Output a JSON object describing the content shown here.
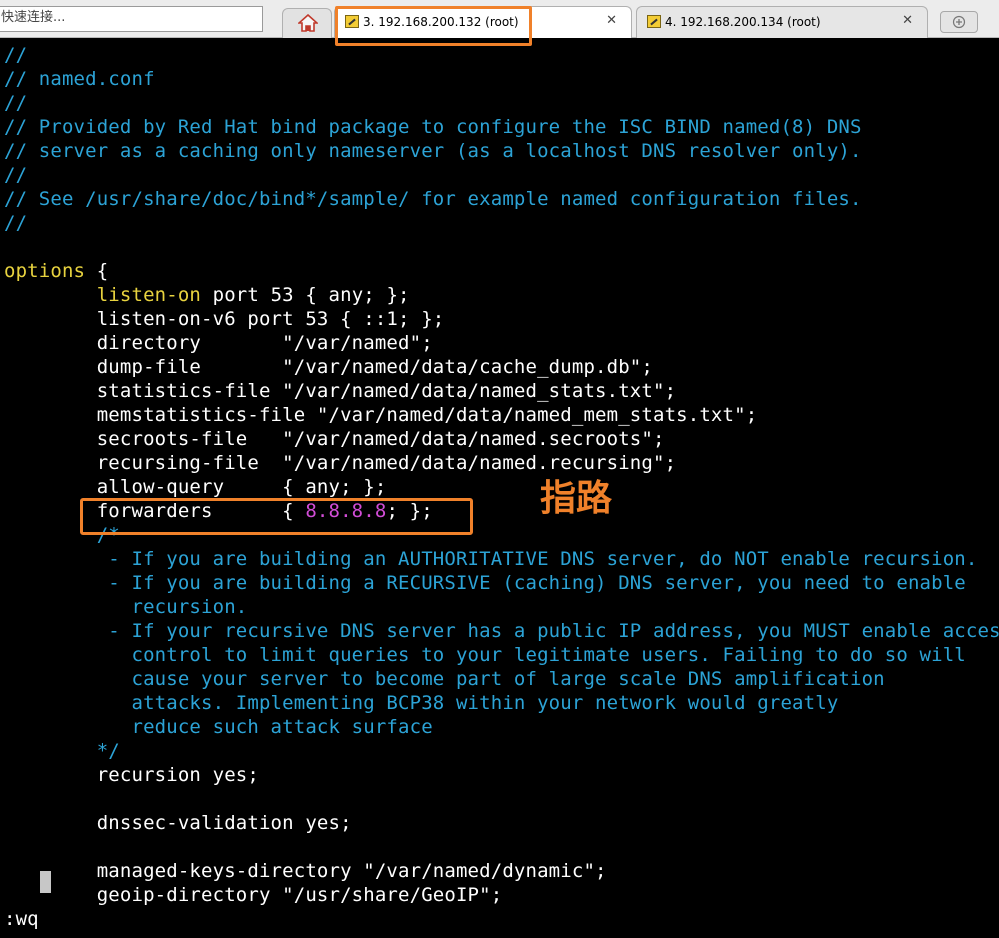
{
  "toolbar": {
    "quick_connect_text": "快速连接..."
  },
  "tabs": [
    {
      "label": "3. 192.168.200.132 (root)",
      "active": true,
      "close": "✕"
    },
    {
      "label": "4. 192.168.200.134 (root)",
      "active": false,
      "close": "✕"
    }
  ],
  "colors": {
    "comment": "#2ca3d6",
    "keyword": "#e8d33f",
    "number": "#d24dd7",
    "highlight": "#f0812a"
  },
  "terminal": {
    "lines": [
      [
        {
          "t": "//",
          "c": "cmt"
        }
      ],
      [
        {
          "t": "// named.conf",
          "c": "cmt"
        }
      ],
      [
        {
          "t": "//",
          "c": "cmt"
        }
      ],
      [
        {
          "t": "// Provided by Red Hat bind package to configure the ISC BIND named(8) DNS",
          "c": "cmt"
        }
      ],
      [
        {
          "t": "// server as a caching only nameserver (as a localhost DNS resolver only).",
          "c": "cmt"
        }
      ],
      [
        {
          "t": "//",
          "c": "cmt"
        }
      ],
      [
        {
          "t": "// See /usr/share/doc/bind*/sample/ for example named configuration files.",
          "c": "cmt"
        }
      ],
      [
        {
          "t": "//",
          "c": "cmt"
        }
      ],
      [],
      [
        {
          "t": "options",
          "c": "kw"
        },
        {
          "t": " {",
          "c": "wht"
        }
      ],
      [
        {
          "t": "        ",
          "c": "wht"
        },
        {
          "t": "listen-on",
          "c": "kw"
        },
        {
          "t": " port 53 { any; };",
          "c": "wht"
        }
      ],
      [
        {
          "t": "        listen-on-v6 port 53 { ::1; };",
          "c": "wht"
        }
      ],
      [
        {
          "t": "        directory       \"/var/named\";",
          "c": "wht"
        }
      ],
      [
        {
          "t": "        dump-file       \"/var/named/data/cache_dump.db\";",
          "c": "wht"
        }
      ],
      [
        {
          "t": "        statistics-file \"/var/named/data/named_stats.txt\";",
          "c": "wht"
        }
      ],
      [
        {
          "t": "        memstatistics-file \"/var/named/data/named_mem_stats.txt\";",
          "c": "wht"
        }
      ],
      [
        {
          "t": "        secroots-file   \"/var/named/data/named.secroots\";",
          "c": "wht"
        }
      ],
      [
        {
          "t": "        recursing-file  \"/var/named/data/named.recursing\";",
          "c": "wht"
        }
      ],
      [
        {
          "t": "        allow-query     { any; };",
          "c": "wht"
        }
      ],
      [
        {
          "t": "        forwarders      { ",
          "c": "wht"
        },
        {
          "t": "8.8.8.8",
          "c": "num"
        },
        {
          "t": "; };",
          "c": "wht"
        }
      ],
      [
        {
          "t": "        /*",
          "c": "cmt"
        }
      ],
      [
        {
          "t": "         - If you are building an AUTHORITATIVE DNS server, do NOT enable recursion.",
          "c": "cmt"
        }
      ],
      [
        {
          "t": "         - If you are building a RECURSIVE (caching) DNS server, you need to enable",
          "c": "cmt"
        }
      ],
      [
        {
          "t": "           recursion.",
          "c": "cmt"
        }
      ],
      [
        {
          "t": "         - If your recursive DNS server has a public IP address, you MUST enable access",
          "c": "cmt"
        }
      ],
      [
        {
          "t": "           control to limit queries to your legitimate users. Failing to do so will",
          "c": "cmt"
        }
      ],
      [
        {
          "t": "           cause your server to become part of large scale DNS amplification",
          "c": "cmt"
        }
      ],
      [
        {
          "t": "           attacks. Implementing BCP38 within your network would greatly",
          "c": "cmt"
        }
      ],
      [
        {
          "t": "           reduce such attack surface",
          "c": "cmt"
        }
      ],
      [
        {
          "t": "        */",
          "c": "cmt"
        }
      ],
      [
        {
          "t": "        recursion yes;",
          "c": "wht"
        }
      ],
      [],
      [
        {
          "t": "        dnssec-validation yes;",
          "c": "wht"
        }
      ],
      [],
      [
        {
          "t": "        managed-keys-directory \"/var/named/dynamic\";",
          "c": "wht"
        }
      ],
      [
        {
          "t": "        geoip-directory \"/usr/share/GeoIP\";",
          "c": "wht"
        }
      ],
      [
        {
          "t": ":wq",
          "c": "wht"
        }
      ]
    ]
  },
  "annotation": {
    "text": "指路"
  }
}
